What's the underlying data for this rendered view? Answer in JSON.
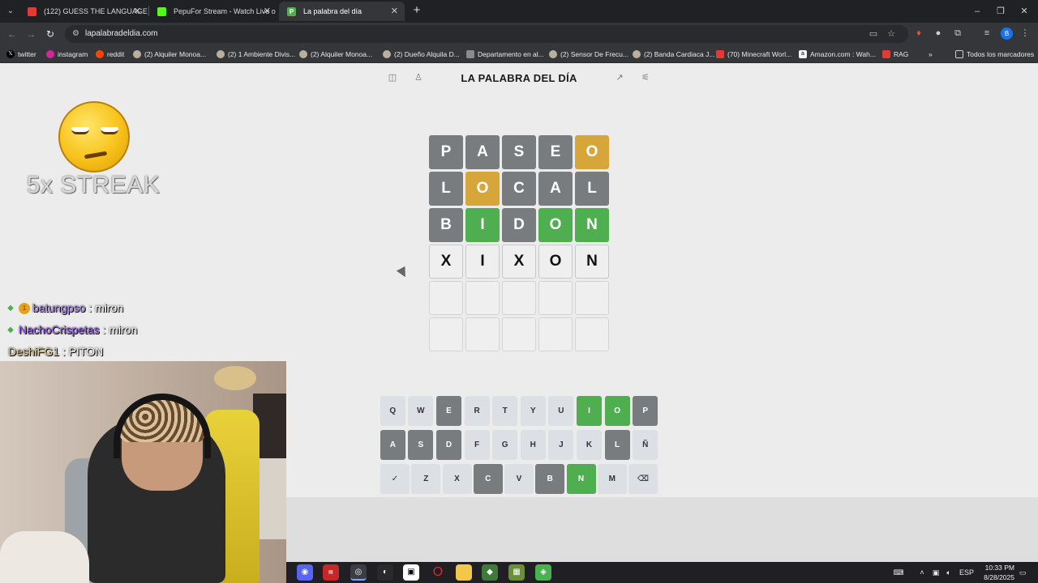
{
  "browser": {
    "tabs": [
      {
        "title": "(122) GUESS THE LANGUAGE V",
        "active": false,
        "favicon": "youtube-icon"
      },
      {
        "title": "PepuFor Stream - Watch Live o",
        "active": false,
        "favicon": "kick-icon"
      },
      {
        "title": "La palabra del día",
        "active": true,
        "favicon": "palabra-icon"
      }
    ],
    "url": "lapalabradeldia.com",
    "bookmarks": [
      {
        "label": "twitter",
        "icon": "x-icon"
      },
      {
        "label": "instagram",
        "icon": "instagram-icon"
      },
      {
        "label": "reddit",
        "icon": "reddit-icon"
      },
      {
        "label": "(2) Alquiler Monoa...",
        "icon": "marketplace-icon"
      },
      {
        "label": "(2) 1 Ambiente Divis...",
        "icon": "marketplace-icon"
      },
      {
        "label": "(2) Alquiler Monoa...",
        "icon": "marketplace-icon"
      },
      {
        "label": "(2) Dueño Alquila D...",
        "icon": "marketplace-icon"
      },
      {
        "label": "Departamento en al...",
        "icon": "listing-icon"
      },
      {
        "label": "(2) Sensor De Frecu...",
        "icon": "marketplace-icon"
      },
      {
        "label": "(2) Banda Cardiaca J...",
        "icon": "marketplace-icon"
      },
      {
        "label": "(70) Minecraft Worl...",
        "icon": "youtube-icon"
      },
      {
        "label": "Amazon.com : Wah...",
        "icon": "amazon-icon"
      },
      {
        "label": "RAG",
        "icon": "youtube-icon"
      }
    ],
    "all_bookmarks": "Todos los marcadores",
    "profile_initial": "B"
  },
  "game": {
    "title": "LA PALABRA DEL DÍA",
    "rows": [
      [
        {
          "l": "P",
          "s": "grey"
        },
        {
          "l": "A",
          "s": "grey"
        },
        {
          "l": "S",
          "s": "grey"
        },
        {
          "l": "E",
          "s": "grey"
        },
        {
          "l": "O",
          "s": "yellow"
        }
      ],
      [
        {
          "l": "L",
          "s": "grey"
        },
        {
          "l": "O",
          "s": "yellow"
        },
        {
          "l": "C",
          "s": "grey"
        },
        {
          "l": "A",
          "s": "grey"
        },
        {
          "l": "L",
          "s": "grey"
        }
      ],
      [
        {
          "l": "B",
          "s": "grey"
        },
        {
          "l": "I",
          "s": "green"
        },
        {
          "l": "D",
          "s": "grey"
        },
        {
          "l": "O",
          "s": "green"
        },
        {
          "l": "N",
          "s": "green"
        }
      ],
      [
        {
          "l": "X",
          "s": "typed"
        },
        {
          "l": "I",
          "s": "typed"
        },
        {
          "l": "X",
          "s": "typed"
        },
        {
          "l": "O",
          "s": "typed"
        },
        {
          "l": "N",
          "s": "typed"
        }
      ],
      [
        {
          "l": "",
          "s": "empty"
        },
        {
          "l": "",
          "s": "empty"
        },
        {
          "l": "",
          "s": "empty"
        },
        {
          "l": "",
          "s": "empty"
        },
        {
          "l": "",
          "s": "empty"
        }
      ],
      [
        {
          "l": "",
          "s": "empty"
        },
        {
          "l": "",
          "s": "empty"
        },
        {
          "l": "",
          "s": "empty"
        },
        {
          "l": "",
          "s": "empty"
        },
        {
          "l": "",
          "s": "empty"
        }
      ]
    ],
    "keyboard": [
      [
        {
          "k": "Q",
          "s": "none"
        },
        {
          "k": "W",
          "s": "none"
        },
        {
          "k": "E",
          "s": "grey"
        },
        {
          "k": "R",
          "s": "none"
        },
        {
          "k": "T",
          "s": "none"
        },
        {
          "k": "Y",
          "s": "none"
        },
        {
          "k": "U",
          "s": "none"
        },
        {
          "k": "I",
          "s": "green"
        },
        {
          "k": "O",
          "s": "green"
        },
        {
          "k": "P",
          "s": "grey"
        }
      ],
      [
        {
          "k": "A",
          "s": "grey"
        },
        {
          "k": "S",
          "s": "grey"
        },
        {
          "k": "D",
          "s": "grey"
        },
        {
          "k": "F",
          "s": "none"
        },
        {
          "k": "G",
          "s": "none"
        },
        {
          "k": "H",
          "s": "none"
        },
        {
          "k": "J",
          "s": "none"
        },
        {
          "k": "K",
          "s": "none"
        },
        {
          "k": "L",
          "s": "grey"
        },
        {
          "k": "Ñ",
          "s": "none"
        }
      ],
      [
        {
          "k": "✓",
          "s": "none",
          "name": "enter-key"
        },
        {
          "k": "Z",
          "s": "none"
        },
        {
          "k": "X",
          "s": "none"
        },
        {
          "k": "C",
          "s": "grey"
        },
        {
          "k": "V",
          "s": "none"
        },
        {
          "k": "B",
          "s": "grey"
        },
        {
          "k": "N",
          "s": "green"
        },
        {
          "k": "M",
          "s": "none"
        },
        {
          "k": "⌫",
          "s": "none",
          "name": "backspace-key"
        }
      ]
    ]
  },
  "overlay": {
    "streak": "5x STREAK",
    "chat": [
      {
        "user": "batungpso",
        "msg": ": miron",
        "user_color": "#b18cf0"
      },
      {
        "user": "NachoCrispetas",
        "msg": ": miron",
        "user_color": "#9b59ff"
      },
      {
        "user": "DeshiFG1",
        "msg": ": PITON",
        "user_color": "#e0c8a0"
      }
    ]
  },
  "taskbar": {
    "apps": [
      "discord-icon",
      "voicemeeter-icon",
      "chrome-icon",
      "obs-icon",
      "capcut-icon",
      "opera-icon",
      "folder-icon",
      "minecraft-launcher-icon",
      "minecraft-icon",
      "minecraft-block-icon"
    ],
    "lang": "ESP",
    "time": "10:33 PM",
    "date": "8/28/2025"
  },
  "colors": {
    "tile_grey": "#787c7e",
    "tile_yellow": "#d6a63a",
    "tile_green": "#4fae4f",
    "key_default": "#dce0e5"
  }
}
